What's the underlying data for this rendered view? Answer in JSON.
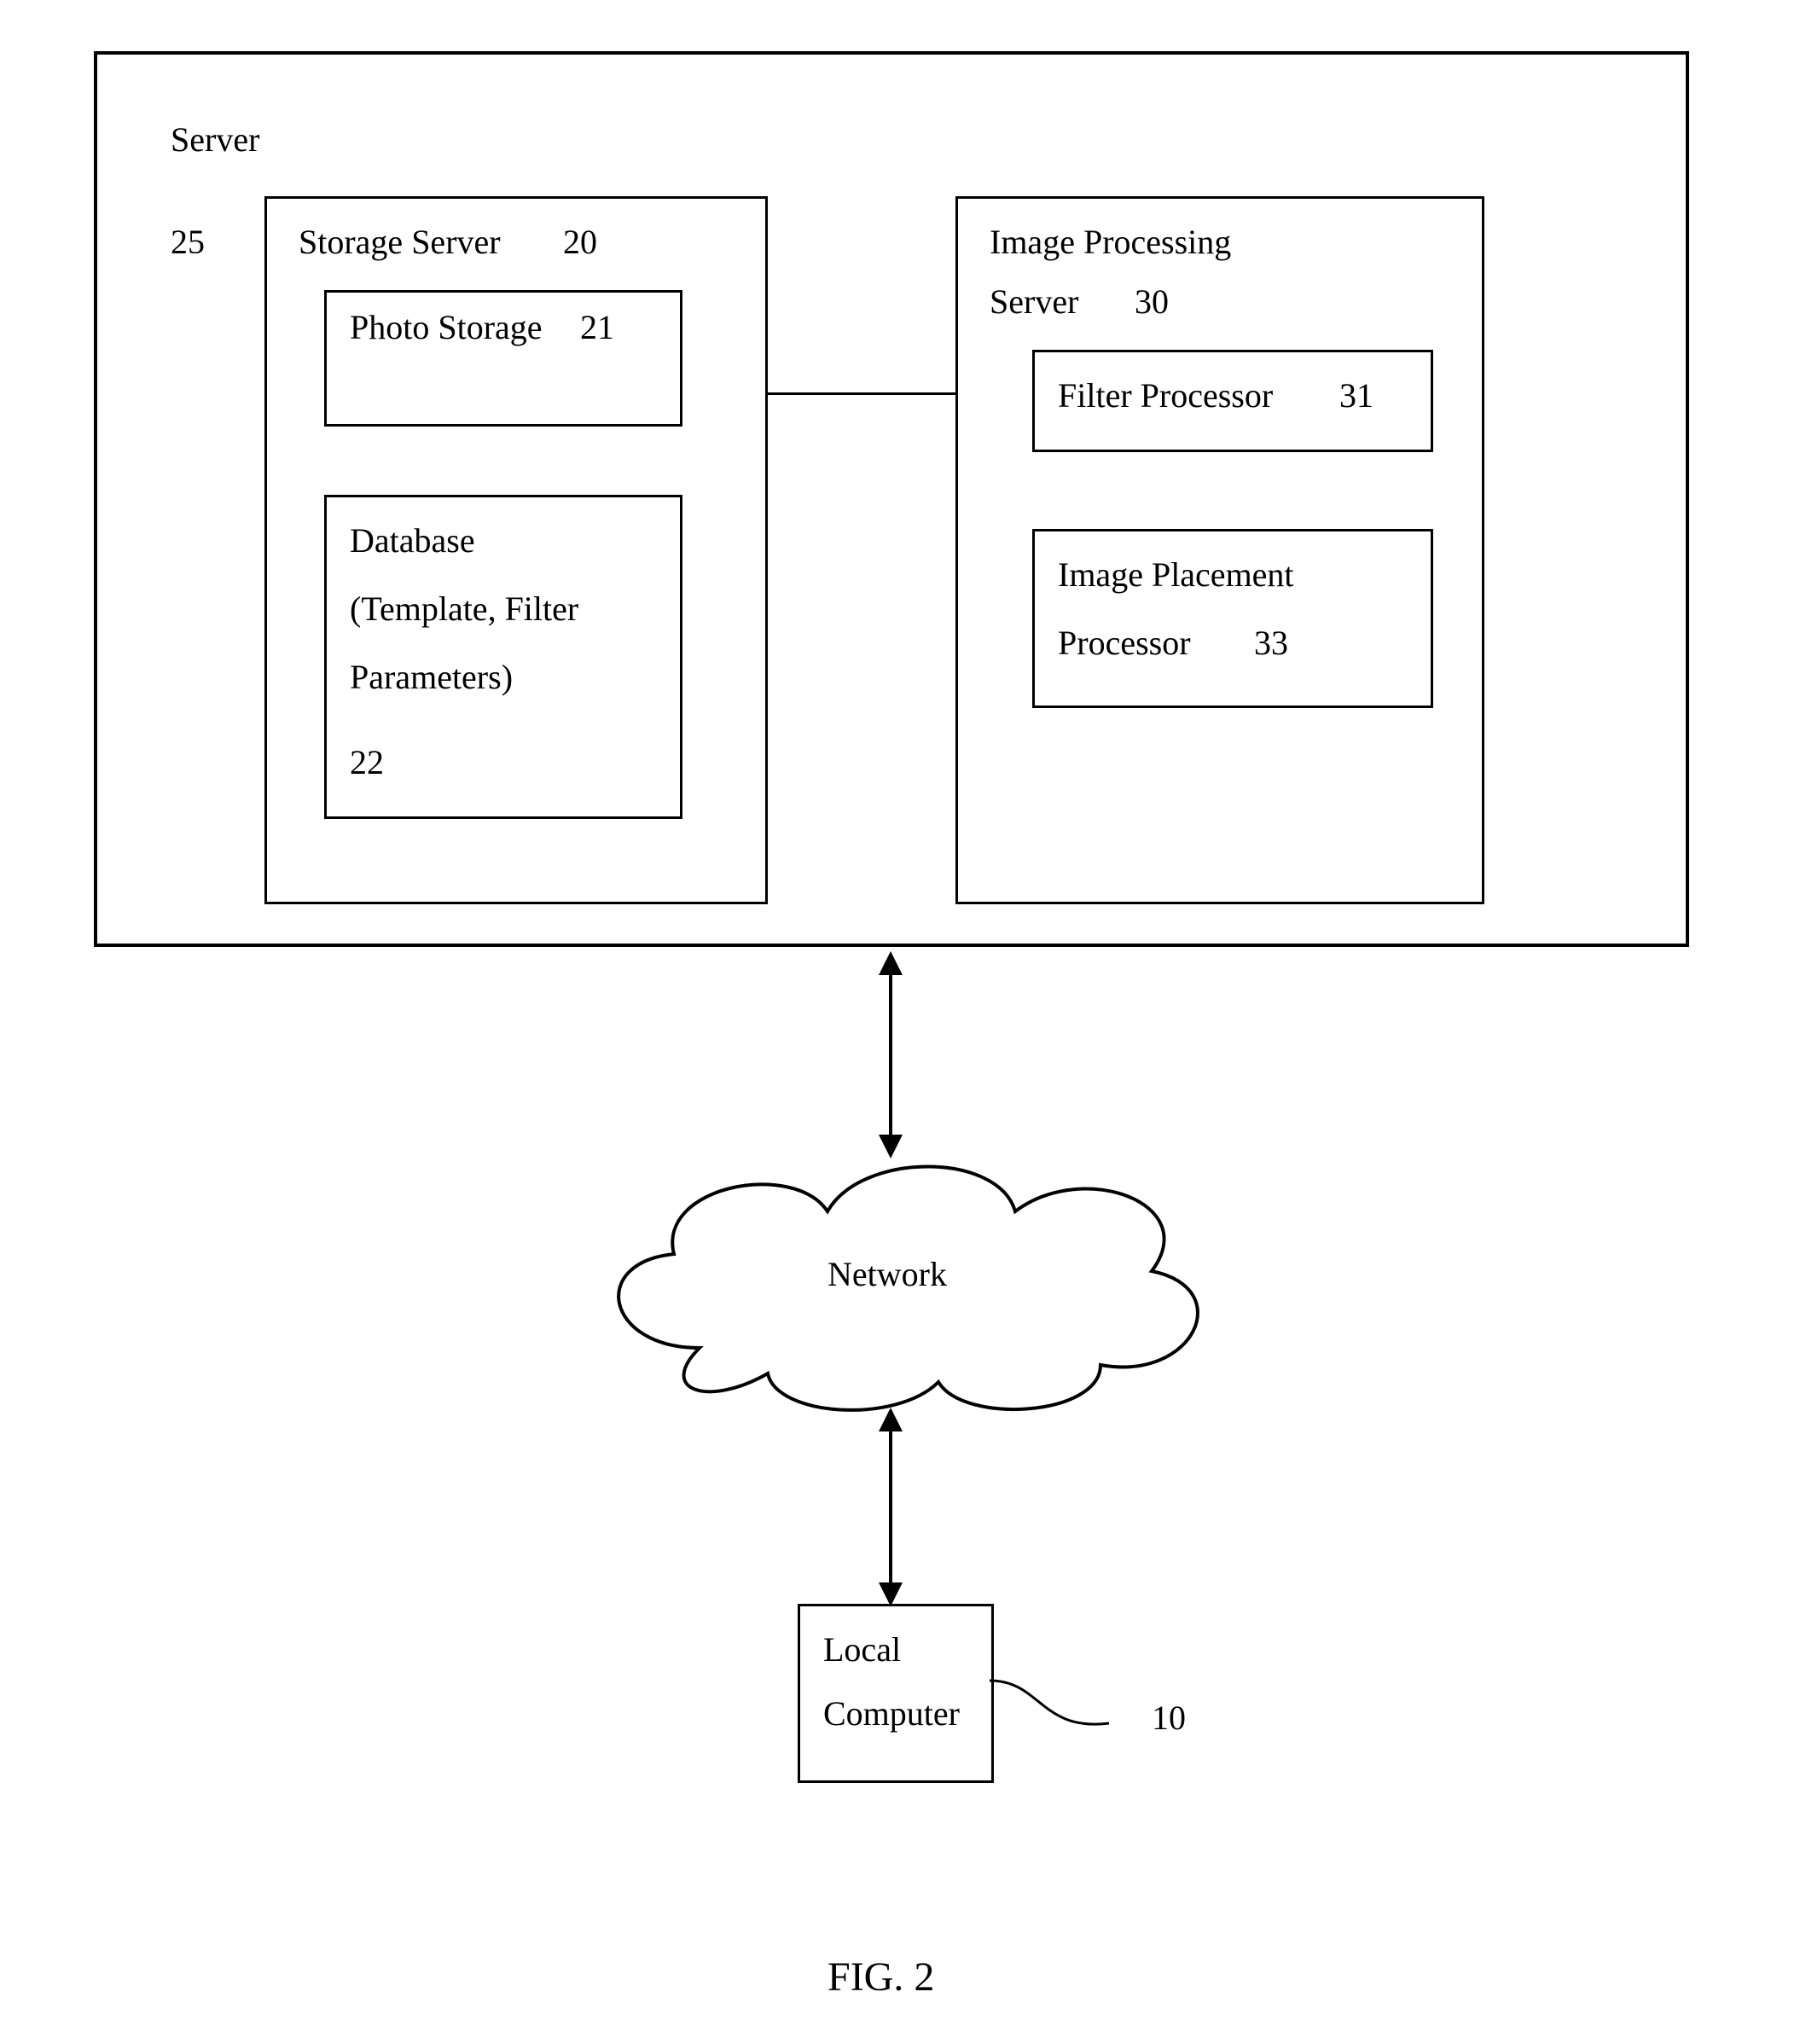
{
  "serverBox": {
    "title": "Server",
    "ref": "25"
  },
  "storageServer": {
    "title": "Storage Server",
    "ref": "20",
    "photoStorage": {
      "title": "Photo Storage",
      "ref": "21"
    },
    "database": {
      "line1": "Database",
      "line2": "(Template, Filter",
      "line3": "Parameters)",
      "ref": "22"
    }
  },
  "imageProcessingServer": {
    "line1": "Image Processing",
    "line2": "Server",
    "ref": "30",
    "filterProcessor": {
      "title": "Filter Processor",
      "ref": "31"
    },
    "imagePlacementProcessor": {
      "line1": "Image Placement",
      "line2": "Processor",
      "ref": "33"
    }
  },
  "network": {
    "label": "Network"
  },
  "localComputer": {
    "line1": "Local",
    "line2": "Computer",
    "ref": "10"
  },
  "figure": {
    "caption": "FIG. 2"
  }
}
